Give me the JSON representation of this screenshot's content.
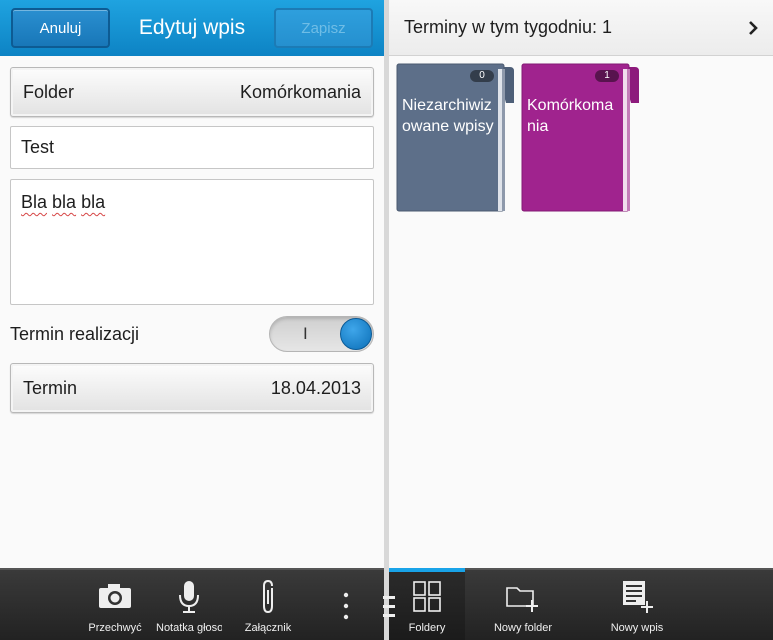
{
  "edit_panel": {
    "cancel_label": "Anuluj",
    "title": "Edytuj wpis",
    "save_label": "Zapisz",
    "folder_label": "Folder",
    "folder_value": "Komórkomania",
    "title_value": "Test",
    "body_words": [
      "Bla",
      "bla",
      "bla"
    ],
    "deadline_toggle_label": "Termin realizacji",
    "deadline_toggle_mark": "I",
    "deadline_toggle_on": true,
    "deadline_label": "Termin",
    "deadline_value": "18.04.2013"
  },
  "edit_actions": [
    {
      "label": "Przechwyć",
      "icon": "camera-icon"
    },
    {
      "label": "Notatka głosowa",
      "icon": "microphone-icon"
    },
    {
      "label": "Załącznik",
      "icon": "paperclip-icon"
    },
    {
      "label": "",
      "icon": "overflow-menu-icon"
    }
  ],
  "week_panel": {
    "header": "Terminy w tym tygodniu: 1",
    "folders": [
      {
        "name": "Niezarchiwizowane wpisy",
        "count": "0",
        "color": "#5d6f89"
      },
      {
        "name": "Komórkomania",
        "count": "1",
        "color": "#a0238e"
      }
    ]
  },
  "main_actions": [
    {
      "label": "Foldery",
      "icon": "folders-grid-icon",
      "active": true
    },
    {
      "label": "Nowy folder",
      "icon": "new-folder-icon"
    },
    {
      "label": "Nowy wpis",
      "icon": "new-entry-icon"
    }
  ],
  "colors": {
    "accent": "#0d83c4",
    "active_tab": "#19a3e8",
    "folder_unarchived": "#5d6f89",
    "folder_komorkomania": "#a0238e"
  }
}
